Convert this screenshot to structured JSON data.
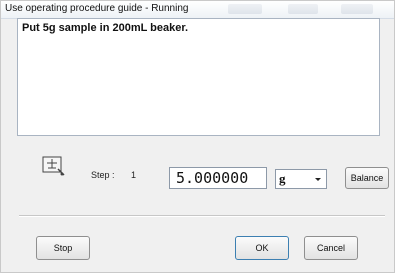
{
  "window": {
    "title": "Use operating procedure guide - Running"
  },
  "instruction": {
    "text": "Put 5g sample in 200mL beaker."
  },
  "step": {
    "label": "Step :",
    "value": "1",
    "icon": "measure-icon"
  },
  "amount": {
    "value": "5.000000"
  },
  "unit": {
    "selected": "g"
  },
  "buttons": {
    "balance": "Balance",
    "stop": "Stop",
    "ok": "OK",
    "cancel": "Cancel"
  }
}
